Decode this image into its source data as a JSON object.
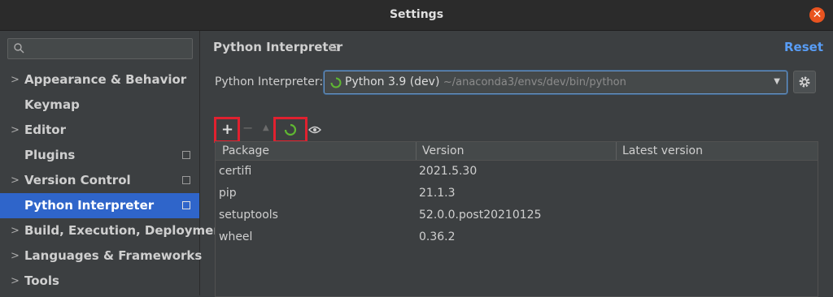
{
  "window": {
    "title": "Settings",
    "close_glyph": "✕"
  },
  "sidebar": {
    "search": {
      "value": "",
      "icon": "search-icon"
    },
    "items": [
      {
        "label": "Appearance & Behavior",
        "expandable": true,
        "page_icon": false,
        "selected": false
      },
      {
        "label": "Keymap",
        "expandable": false,
        "page_icon": false,
        "selected": false
      },
      {
        "label": "Editor",
        "expandable": true,
        "page_icon": false,
        "selected": false
      },
      {
        "label": "Plugins",
        "expandable": false,
        "page_icon": true,
        "selected": false
      },
      {
        "label": "Version Control",
        "expandable": true,
        "page_icon": true,
        "selected": false
      },
      {
        "label": "Python Interpreter",
        "expandable": false,
        "page_icon": true,
        "selected": true
      },
      {
        "label": "Build, Execution, Deployment",
        "expandable": true,
        "page_icon": false,
        "selected": false
      },
      {
        "label": "Languages & Frameworks",
        "expandable": true,
        "page_icon": false,
        "selected": false
      },
      {
        "label": "Tools",
        "expandable": true,
        "page_icon": false,
        "selected": false
      }
    ]
  },
  "main": {
    "title": "Python Interpreter",
    "reset_label": "Reset",
    "interpreter": {
      "label": "Python Interpreter:",
      "name": "Python 3.9 (dev)",
      "path": "~/anaconda3/envs/dev/bin/python"
    },
    "toolbar": {
      "add": "+",
      "remove": "−",
      "upgrade": "▲"
    },
    "table": {
      "columns": [
        "Package",
        "Version",
        "Latest version"
      ],
      "rows": [
        {
          "package": "certifi",
          "version": "2021.5.30",
          "latest": ""
        },
        {
          "package": "pip",
          "version": "21.1.3",
          "latest": ""
        },
        {
          "package": "setuptools",
          "version": "52.0.0.post20210125",
          "latest": ""
        },
        {
          "package": "wheel",
          "version": "0.36.2",
          "latest": ""
        }
      ]
    }
  },
  "colors": {
    "accent": "#2f65ca",
    "link": "#589df6",
    "highlight": "#e0212f",
    "spinner": "#5fb832"
  }
}
